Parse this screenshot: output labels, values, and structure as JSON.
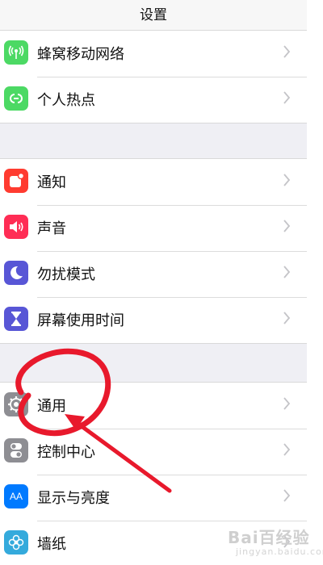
{
  "header": {
    "title": "设置"
  },
  "groups": [
    {
      "items": [
        {
          "label": "蜂窝移动网络",
          "icon": "cellular-icon",
          "color": "#4cd964"
        },
        {
          "label": "个人热点",
          "icon": "hotspot-icon",
          "color": "#4cd964"
        }
      ]
    },
    {
      "items": [
        {
          "label": "通知",
          "icon": "notification-icon",
          "color": "#ff3b30"
        },
        {
          "label": "声音",
          "icon": "sound-icon",
          "color": "#ff2d55"
        },
        {
          "label": "勿扰模式",
          "icon": "moon-icon",
          "color": "#5856d6"
        },
        {
          "label": "屏幕使用时间",
          "icon": "hourglass-icon",
          "color": "#5856d6"
        }
      ]
    },
    {
      "items": [
        {
          "label": "通用",
          "icon": "gear-icon",
          "color": "#8e8e93"
        },
        {
          "label": "控制中心",
          "icon": "control-center-icon",
          "color": "#8e8e93"
        },
        {
          "label": "显示与亮度",
          "icon": "display-icon",
          "color": "#007aff",
          "icon_text": "AA"
        },
        {
          "label": "墙纸",
          "icon": "wallpaper-icon",
          "color": "#34aadc"
        }
      ]
    }
  ],
  "annotation": {
    "color": "#e8192c"
  },
  "watermark": {
    "brand": "Bai百经验",
    "sub": "jingyan.baidu.com"
  }
}
